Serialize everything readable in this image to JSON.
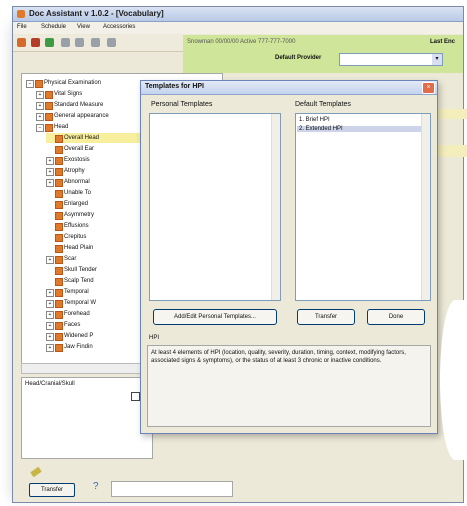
{
  "window": {
    "title": "Doc Assistant v 1.0.2 - [Vocabulary]"
  },
  "menu": [
    "File",
    "Schedule",
    "View",
    "Accessories"
  ],
  "patient": {
    "name_line": "Snowman  00/00/00  Active  777-777-7000",
    "last_enc_label": "Last Enc",
    "default_provider_label": "Default Provider",
    "provider_value": ""
  },
  "tree": {
    "items": [
      {
        "label": "Physical Examination",
        "toggle": "−",
        "indent": 0
      },
      {
        "label": "Vital Signs",
        "toggle": "+",
        "indent": 1
      },
      {
        "label": "Standard Measure",
        "toggle": "+",
        "indent": 1
      },
      {
        "label": "General appearance",
        "toggle": "+",
        "indent": 1
      },
      {
        "label": "Head",
        "toggle": "−",
        "indent": 1
      },
      {
        "label": "Overall Head",
        "toggle": "",
        "indent": 2
      },
      {
        "label": "Overall Ear",
        "toggle": "",
        "indent": 2
      },
      {
        "label": "Exostosis",
        "toggle": "+",
        "indent": 2
      },
      {
        "label": "Atrophy",
        "toggle": "+",
        "indent": 2
      },
      {
        "label": "Abnormal",
        "toggle": "+",
        "indent": 2
      },
      {
        "label": "Unable To",
        "toggle": "",
        "indent": 2
      },
      {
        "label": "Enlarged",
        "toggle": "",
        "indent": 2
      },
      {
        "label": "Asymmetry",
        "toggle": "",
        "indent": 2
      },
      {
        "label": "Effusions",
        "toggle": "",
        "indent": 2
      },
      {
        "label": "Crepitus",
        "toggle": "",
        "indent": 2
      },
      {
        "label": "Head Plain",
        "toggle": "",
        "indent": 2
      },
      {
        "label": "Scar",
        "toggle": "+",
        "indent": 2
      },
      {
        "label": "Skull Tender",
        "toggle": "",
        "indent": 2
      },
      {
        "label": "Scalp Tend",
        "toggle": "",
        "indent": 2
      },
      {
        "label": "Temporal",
        "toggle": "+",
        "indent": 2
      },
      {
        "label": "Temporal W",
        "toggle": "+",
        "indent": 2
      },
      {
        "label": "Forehead",
        "toggle": "+",
        "indent": 2
      },
      {
        "label": "Faces",
        "toggle": "+",
        "indent": 2
      },
      {
        "label": "Widened P",
        "toggle": "+",
        "indent": 2
      },
      {
        "label": "Jaw Findin",
        "toggle": "+",
        "indent": 2
      }
    ],
    "selected_index": 5
  },
  "note_panel_text": "Head/Cranial/Skull",
  "transfer_main_label": "Transfer",
  "dialog": {
    "title": "Templates for HPI",
    "personal_label": "Personal Templates",
    "default_label": "Default Templates",
    "personal_items": [],
    "default_items": [
      "1. Brief HPI",
      "2. Extended HPI"
    ],
    "default_selected": 1,
    "add_button": "Add/Edit Personal Templates...",
    "transfer_button": "Transfer",
    "done_button": "Done",
    "hpi_label": "HPI",
    "hpi_text": "At least 4 elements of HPI (location, quality, severity, duration, timing, context, modifying factors, associated signs & symptoms), or the status of at least 3 chronic or inactive conditions."
  },
  "colors": {
    "accent_green": "#cfe59a",
    "highlight_yellow": "#f7ef9e",
    "tree_icon": "#e07a2a"
  }
}
